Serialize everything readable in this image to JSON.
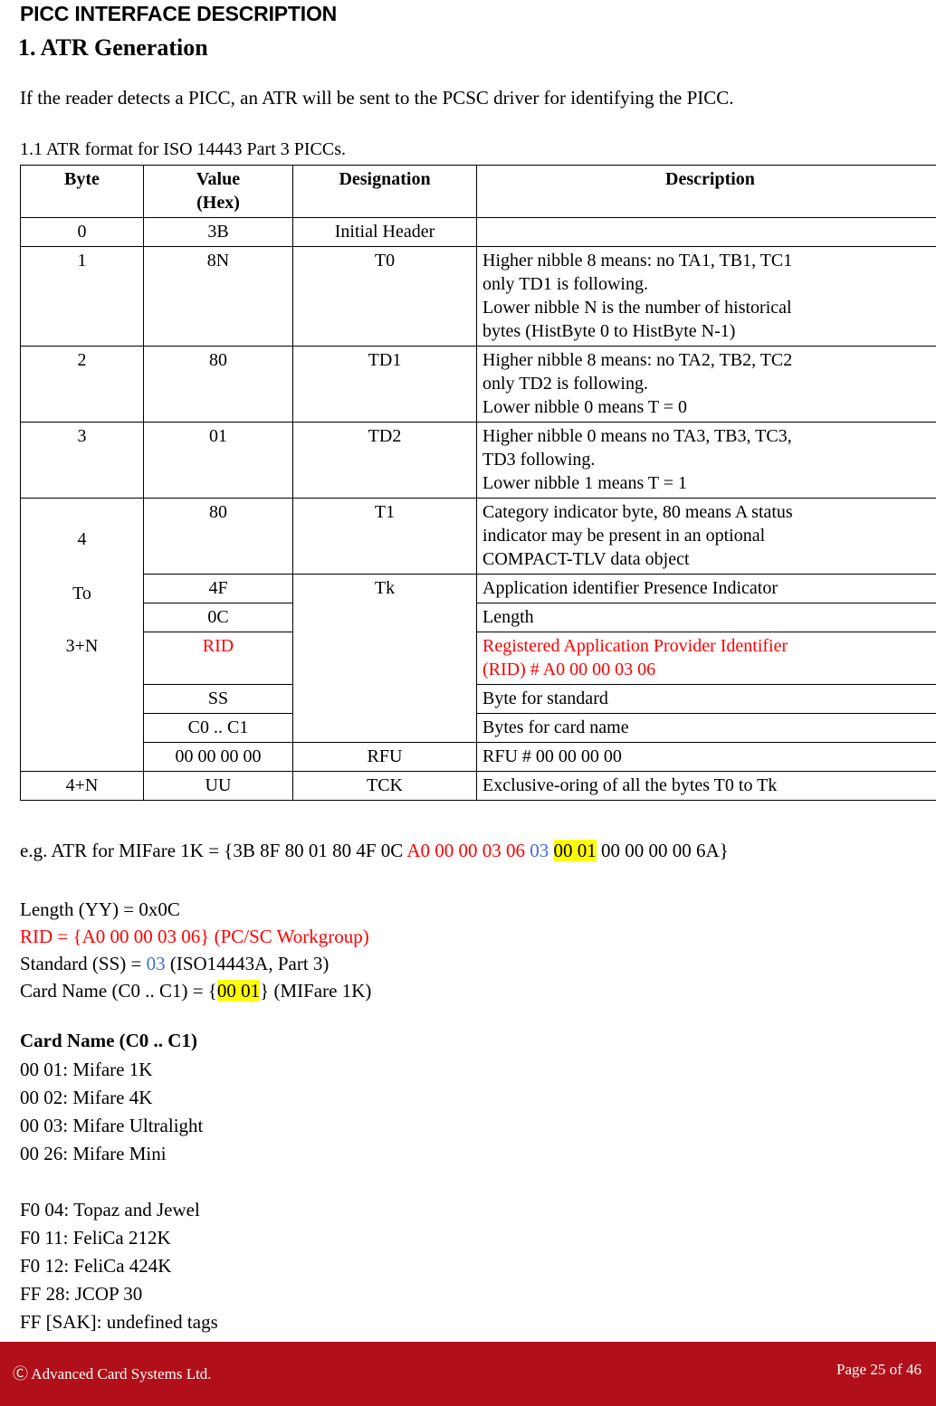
{
  "document": {
    "header_title": "PICC INTERFACE DESCRIPTION",
    "section_heading": "1. ATR Generation",
    "intro_paragraph": "If the reader detects a PICC, an ATR will be sent to the PCSC driver for identifying the PICC.",
    "subheading": "1.1 ATR format for ISO 14443 Part 3 PICCs."
  },
  "table": {
    "headers": {
      "byte": "Byte",
      "value_line1": "Value",
      "value_line2": "(Hex)",
      "designation": "Designation",
      "description": "Description"
    },
    "rows": {
      "r0": {
        "byte": "0",
        "value": "3B",
        "designation": "Initial Header",
        "description": ""
      },
      "r1": {
        "byte": "1",
        "value": "8N",
        "designation": "T0",
        "desc_l1": "Higher nibble 8 means: no TA1, TB1, TC1",
        "desc_l2": "only TD1 is following.",
        "desc_l3": "Lower nibble N is the number of historical",
        "desc_l4": "bytes (HistByte 0 to HistByte N-1)"
      },
      "r2": {
        "byte": "2",
        "value": "80",
        "designation": "TD1",
        "desc_l1": "Higher nibble 8 means: no TA2, TB2, TC2",
        "desc_l2": "only TD2 is following.",
        "desc_l3": "Lower nibble 0 means T = 0"
      },
      "r3": {
        "byte": "3",
        "value": "01",
        "designation": "TD2",
        "desc_l1": "Higher nibble 0 means no TA3, TB3, TC3,",
        "desc_l2": "TD3 following.",
        "desc_l3": "Lower nibble 1 means T = 1"
      },
      "span_byte": {
        "line1": "4",
        "line2": "To",
        "line3": "3+N"
      },
      "r4": {
        "value": "80",
        "designation": "T1",
        "desc_l1": "Category indicator byte, 80 means A status",
        "desc_l2": "indicator may be present in an optional",
        "desc_l3": "COMPACT-TLV data object"
      },
      "r5": {
        "value": "4F",
        "designation": "Tk",
        "description": "Application identifier Presence Indicator"
      },
      "r6": {
        "value": "0C",
        "description": "Length"
      },
      "r7": {
        "value": "RID",
        "desc_l1": "Registered Application Provider Identifier",
        "desc_l2": "(RID) # A0 00 00 03 06"
      },
      "r8": {
        "value": "SS",
        "description": "Byte for standard"
      },
      "r9": {
        "value": "C0 .. C1",
        "description": "Bytes for card name"
      },
      "r10": {
        "value": "00 00 00 00",
        "designation": "RFU",
        "description": "RFU # 00 00 00 00"
      },
      "r11": {
        "byte": "4+N",
        "value": "UU",
        "designation": "TCK",
        "description": "Exclusive-oring of all the bytes T0 to Tk"
      }
    }
  },
  "example": {
    "prefix": "e.g. ATR for MIFare 1K  = {3B 8F 80 01 80 4F 0C ",
    "rid_bytes": "A0 00 00 03 06",
    "space1": " ",
    "ss_byte": "03",
    "space2": " ",
    "card_name_bytes": "00 01",
    "suffix": " 00 00 00 00 6A}"
  },
  "legend": {
    "length_line": "Length (YY) = 0x0C",
    "rid_line": "RID = {A0 00 00 03 06} (PC/SC Workgroup)",
    "standard_prefix": "Standard (SS) = ",
    "standard_value": "03",
    "standard_suffix": " (ISO14443A, Part 3)",
    "cardname_prefix": "Card Name (C0 .. C1) = {",
    "cardname_value": "00 01",
    "cardname_suffix": "} (MIFare 1K)"
  },
  "card_names": {
    "title": "Card Name (C0 .. C1)",
    "group1": [
      "00 01: Mifare 1K",
      "00 02: Mifare 4K",
      "00 03: Mifare Ultralight",
      "00 26: Mifare Mini"
    ],
    "group2": [
      "F0 04: Topaz and Jewel",
      "F0 11: FeliCa 212K",
      "F0 12: FeliCa 424K",
      "FF 28: JCOP 30",
      "FF [SAK]: undefined tags"
    ]
  },
  "footer": {
    "copyright": "Ⓒ Advanced Card Systems Ltd.",
    "page_label": "Page 25 of 46"
  },
  "colors": {
    "highlight": "#ffff00",
    "red": "#ff0000",
    "blue": "#4169e1",
    "footer_bar": "#b1101a"
  }
}
